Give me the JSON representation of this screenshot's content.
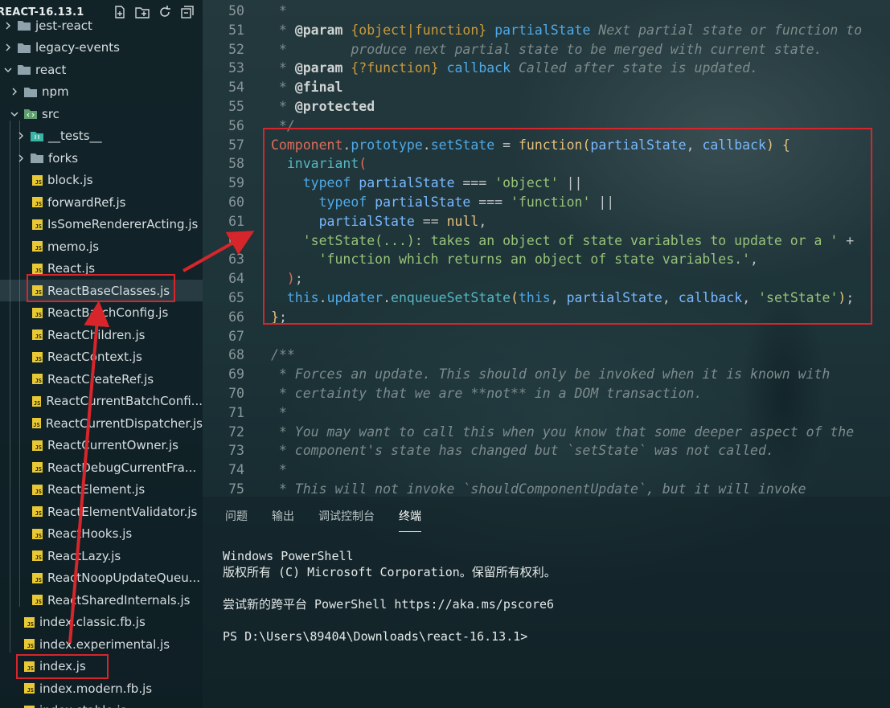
{
  "explorer": {
    "title": "REACT-16.13.1",
    "actions": [
      "new-file-icon",
      "new-folder-icon",
      "refresh-icon",
      "collapse-all-icon"
    ],
    "items": [
      {
        "label": "jest-react",
        "type": "folder",
        "depth": 0,
        "expanded": false
      },
      {
        "label": "legacy-events",
        "type": "folder",
        "depth": 0,
        "expanded": false
      },
      {
        "label": "react",
        "type": "folder",
        "depth": 0,
        "expanded": true
      },
      {
        "label": "npm",
        "type": "folder",
        "depth": 1,
        "expanded": false
      },
      {
        "label": "src",
        "type": "src-folder",
        "depth": 1,
        "expanded": true
      },
      {
        "label": "__tests__",
        "type": "test-folder",
        "depth": 2,
        "expanded": false
      },
      {
        "label": "forks",
        "type": "folder",
        "depth": 2,
        "expanded": false
      },
      {
        "label": "block.js",
        "type": "js",
        "depth": 2
      },
      {
        "label": "forwardRef.js",
        "type": "js",
        "depth": 2
      },
      {
        "label": "IsSomeRendererActing.js",
        "type": "js",
        "depth": 2
      },
      {
        "label": "memo.js",
        "type": "js",
        "depth": 2
      },
      {
        "label": "React.js",
        "type": "js",
        "depth": 2
      },
      {
        "label": "ReactBaseClasses.js",
        "type": "js",
        "depth": 2,
        "selected": true
      },
      {
        "label": "ReactBatchConfig.js",
        "type": "js",
        "depth": 2
      },
      {
        "label": "ReactChildren.js",
        "type": "js",
        "depth": 2
      },
      {
        "label": "ReactContext.js",
        "type": "js",
        "depth": 2
      },
      {
        "label": "ReactCreateRef.js",
        "type": "js",
        "depth": 2
      },
      {
        "label": "ReactCurrentBatchConfi...",
        "type": "js",
        "depth": 2
      },
      {
        "label": "ReactCurrentDispatcher.js",
        "type": "js",
        "depth": 2
      },
      {
        "label": "ReactCurrentOwner.js",
        "type": "js",
        "depth": 2
      },
      {
        "label": "ReactDebugCurrentFra...",
        "type": "js",
        "depth": 2
      },
      {
        "label": "ReactElement.js",
        "type": "js",
        "depth": 2
      },
      {
        "label": "ReactElementValidator.js",
        "type": "js",
        "depth": 2
      },
      {
        "label": "ReactHooks.js",
        "type": "js",
        "depth": 2
      },
      {
        "label": "ReactLazy.js",
        "type": "js",
        "depth": 2
      },
      {
        "label": "ReactNoopUpdateQueu...",
        "type": "js",
        "depth": 2
      },
      {
        "label": "ReactSharedInternals.js",
        "type": "js",
        "depth": 2
      },
      {
        "label": "index.classic.fb.js",
        "type": "js",
        "depth": 1
      },
      {
        "label": "index.experimental.js",
        "type": "js",
        "depth": 1
      },
      {
        "label": "index.js",
        "type": "js",
        "depth": 1
      },
      {
        "label": "index.modern.fb.js",
        "type": "js",
        "depth": 1
      },
      {
        "label": "index.stable.js",
        "type": "js",
        "depth": 1
      }
    ]
  },
  "editor": {
    "lines": [
      {
        "n": "50",
        "parts": [
          [
            "cm",
            " *"
          ]
        ]
      },
      {
        "n": "51",
        "parts": [
          [
            "cm",
            " * "
          ],
          [
            "tag",
            "@param"
          ],
          [
            "cm",
            " "
          ],
          [
            "type",
            "{object|function}"
          ],
          [
            "cm",
            " "
          ],
          [
            "pname",
            "partialState"
          ],
          [
            "cm",
            " Next partial state or function to"
          ]
        ]
      },
      {
        "n": "52",
        "parts": [
          [
            "cm",
            " *        produce next partial state to be merged with current state."
          ]
        ]
      },
      {
        "n": "53",
        "parts": [
          [
            "cm",
            " * "
          ],
          [
            "tag",
            "@param"
          ],
          [
            "cm",
            " "
          ],
          [
            "type",
            "{?function}"
          ],
          [
            "cm",
            " "
          ],
          [
            "pname",
            "callback"
          ],
          [
            "cm",
            " Called after state is updated."
          ]
        ]
      },
      {
        "n": "54",
        "parts": [
          [
            "cm",
            " * "
          ],
          [
            "tag",
            "@final"
          ]
        ]
      },
      {
        "n": "55",
        "parts": [
          [
            "cm",
            " * "
          ],
          [
            "tag",
            "@protected"
          ]
        ]
      },
      {
        "n": "56",
        "parts": [
          [
            "cm",
            " */"
          ]
        ]
      },
      {
        "n": "57",
        "parts": [
          [
            "red",
            "Component"
          ],
          [
            "op",
            "."
          ],
          [
            "kw",
            "prototype"
          ],
          [
            "op",
            "."
          ],
          [
            "kw",
            "setState"
          ],
          [
            "op",
            " = "
          ],
          [
            "fnkw",
            "function"
          ],
          [
            "paren",
            "("
          ],
          [
            "var",
            "partialState"
          ],
          [
            "op",
            ", "
          ],
          [
            "var",
            "callback"
          ],
          [
            "paren",
            ")"
          ],
          [
            "op",
            " "
          ],
          [
            "paren",
            "{"
          ]
        ]
      },
      {
        "n": "58",
        "parts": [
          [
            "plain",
            "  "
          ],
          [
            "fn",
            "invariant"
          ],
          [
            "red",
            "("
          ]
        ]
      },
      {
        "n": "59",
        "parts": [
          [
            "plain",
            "    "
          ],
          [
            "kw",
            "typeof"
          ],
          [
            "op",
            " "
          ],
          [
            "var",
            "partialState"
          ],
          [
            "op",
            " === "
          ],
          [
            "str",
            "'object'"
          ],
          [
            "op",
            " ||"
          ]
        ]
      },
      {
        "n": "60",
        "parts": [
          [
            "plain",
            "      "
          ],
          [
            "kw",
            "typeof"
          ],
          [
            "op",
            " "
          ],
          [
            "var",
            "partialState"
          ],
          [
            "op",
            " === "
          ],
          [
            "str",
            "'function'"
          ],
          [
            "op",
            " ||"
          ]
        ]
      },
      {
        "n": "61",
        "parts": [
          [
            "plain",
            "      "
          ],
          [
            "var",
            "partialState"
          ],
          [
            "op",
            " == "
          ],
          [
            "nul",
            "null"
          ],
          [
            "op",
            ","
          ]
        ]
      },
      {
        "n": "62",
        "parts": [
          [
            "plain",
            "    "
          ],
          [
            "str",
            "'setState(...): takes an object of state variables to update or a '"
          ],
          [
            "op",
            " +"
          ]
        ]
      },
      {
        "n": "63",
        "parts": [
          [
            "plain",
            "      "
          ],
          [
            "str",
            "'function which returns an object of state variables.'"
          ],
          [
            "op",
            ","
          ]
        ]
      },
      {
        "n": "64",
        "parts": [
          [
            "plain",
            "  "
          ],
          [
            "red",
            ")"
          ],
          [
            "op",
            ";"
          ]
        ]
      },
      {
        "n": "65",
        "parts": [
          [
            "plain",
            "  "
          ],
          [
            "this",
            "this"
          ],
          [
            "op",
            "."
          ],
          [
            "kw",
            "updater"
          ],
          [
            "op",
            "."
          ],
          [
            "fn",
            "enqueueSetState"
          ],
          [
            "paren",
            "("
          ],
          [
            "this",
            "this"
          ],
          [
            "op",
            ", "
          ],
          [
            "var",
            "partialState"
          ],
          [
            "op",
            ", "
          ],
          [
            "var",
            "callback"
          ],
          [
            "op",
            ", "
          ],
          [
            "str",
            "'setState'"
          ],
          [
            "paren",
            ")"
          ],
          [
            "op",
            ";"
          ]
        ]
      },
      {
        "n": "66",
        "parts": [
          [
            "paren",
            "}"
          ],
          [
            "op",
            ";"
          ]
        ]
      },
      {
        "n": "67",
        "parts": [
          [
            "plain",
            ""
          ]
        ]
      },
      {
        "n": "68",
        "parts": [
          [
            "cm",
            "/**"
          ]
        ]
      },
      {
        "n": "69",
        "parts": [
          [
            "cm",
            " * Forces an update. This should only be invoked when it is known with"
          ]
        ]
      },
      {
        "n": "70",
        "parts": [
          [
            "cm",
            " * certainty that we are **not** in a DOM transaction."
          ]
        ]
      },
      {
        "n": "71",
        "parts": [
          [
            "cm",
            " *"
          ]
        ]
      },
      {
        "n": "72",
        "parts": [
          [
            "cm",
            " * You may want to call this when you know that some deeper aspect of the"
          ]
        ]
      },
      {
        "n": "73",
        "parts": [
          [
            "cm",
            " * component's state has changed but `setState` was not called."
          ]
        ]
      },
      {
        "n": "74",
        "parts": [
          [
            "cm",
            " *"
          ]
        ]
      },
      {
        "n": "75",
        "parts": [
          [
            "cm",
            " * This will not invoke `shouldComponentUpdate`, but it will invoke"
          ]
        ]
      }
    ]
  },
  "panel": {
    "tabs": [
      "问题",
      "输出",
      "调试控制台",
      "终端"
    ],
    "active_tab": "终端",
    "terminal": [
      "Windows PowerShell",
      "版权所有 (C) Microsoft Corporation。保留所有权利。",
      "",
      "尝试新的跨平台 PowerShell https://aka.ms/pscore6",
      "",
      "PS D:\\Users\\89404\\Downloads\\react-16.13.1>"
    ]
  },
  "colors": {
    "annotation_red": "#d6262b",
    "js_icon": "#e8c834"
  }
}
